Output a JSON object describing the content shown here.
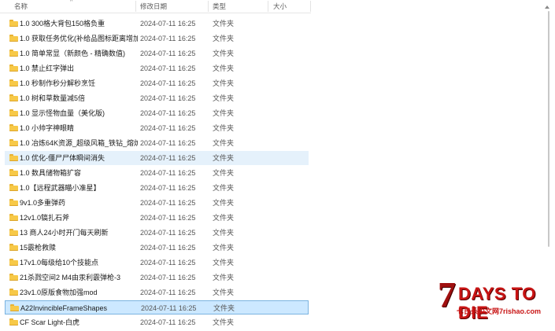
{
  "header": {
    "col_name": "名称",
    "col_date": "修改日期",
    "col_type": "类型",
    "col_size": "大小",
    "sort_glyph": "^"
  },
  "icons": {
    "folder": "folder-icon",
    "sort": "sort-ascending-icon",
    "scroll": "scroll-up-arrow-icon"
  },
  "colors": {
    "selected_bg": "#cce8ff",
    "hover_bg": "#e5f1fb",
    "folder": "#f7c948",
    "logo_red": "#c81414"
  },
  "rows": [
    {
      "name": "1.0 300格大背包150格负重",
      "date": "2024-07-11 16:25",
      "type": "文件夹"
    },
    {
      "name": "1.0 获取任务优化(补给品图标距离增加)",
      "date": "2024-07-11 16:25",
      "type": "文件夹"
    },
    {
      "name": "1.0 简单常显（新颜色 - 精确数值)",
      "date": "2024-07-11 16:25",
      "type": "文件夹"
    },
    {
      "name": "1.0 禁止红字弹出",
      "date": "2024-07-11 16:25",
      "type": "文件夹"
    },
    {
      "name": "1.0 秒制作秒分解秒烹饪",
      "date": "2024-07-11 16:25",
      "type": "文件夹"
    },
    {
      "name": "1.0 树和草数量减5倍",
      "date": "2024-07-11 16:25",
      "type": "文件夹"
    },
    {
      "name": "1.0 显示怪物血量（美化版)",
      "date": "2024-07-11 16:25",
      "type": "文件夹"
    },
    {
      "name": "1.0 小帅字神眼睛",
      "date": "2024-07-11 16:25",
      "type": "文件夹"
    },
    {
      "name": "1.0 冶炼64K资源_超级风箱_铁钻_熔炉槽...",
      "date": "2024-07-11 16:25",
      "type": "文件夹"
    },
    {
      "name": "1.0 优化-僵尸尸体瞬间消失",
      "date": "2024-07-11 16:25",
      "type": "文件夹"
    },
    {
      "name": "1.0 数具储物箱扩容",
      "date": "2024-07-11 16:25",
      "type": "文件夹"
    },
    {
      "name": "1.0【远程武器瞄小准星】",
      "date": "2024-07-11 16:25",
      "type": "文件夹"
    },
    {
      "name": "9v1.0多重弹药",
      "date": "2024-07-11 16:25",
      "type": "文件夹"
    },
    {
      "name": "12v1.0镐扎石斧",
      "date": "2024-07-11 16:25",
      "type": "文件夹"
    },
    {
      "name": "13 商人24小时开门每天刷新",
      "date": "2024-07-11 16:25",
      "type": "文件夹"
    },
    {
      "name": "15霰枪救赎",
      "date": "2024-07-11 16:25",
      "type": "文件夹"
    },
    {
      "name": "17v1.0每级给10个技能点",
      "date": "2024-07-11 16:25",
      "type": "文件夹"
    },
    {
      "name": "21杀戮空间2 M4由汞利霰弹枪-3",
      "date": "2024-07-11 16:25",
      "type": "文件夹"
    },
    {
      "name": "23v1.0原版食物加强mod",
      "date": "2024-07-11 16:25",
      "type": "文件夹"
    },
    {
      "name": "A22InvincibleFrameShapes",
      "date": "2024-07-11 16:25",
      "type": "文件夹"
    },
    {
      "name": "CF Scar Light-白虎",
      "date": "2024-07-11 16:25",
      "type": "文件夹"
    }
  ],
  "states": {
    "hover_index": 9,
    "selected_index": 19
  },
  "logo": {
    "seven": "7",
    "word": "DAYS TO DIE",
    "sub": "七日杀中文网7rishao.com"
  }
}
